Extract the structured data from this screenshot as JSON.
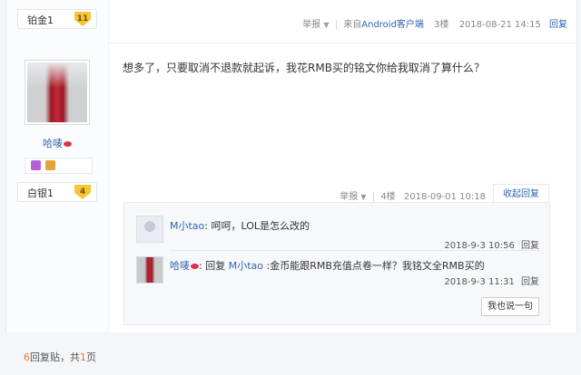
{
  "prev_post": {
    "rank": {
      "label": "铂金1",
      "level": "11"
    },
    "report_label": "举报",
    "source_prefix": "来自",
    "source_link": "Android客户端",
    "floor": "3楼",
    "timestamp": "2018-08-21 14:15",
    "reply_label": "回复"
  },
  "post": {
    "username": "哈唛",
    "rank": {
      "label": "白银1",
      "level": "4"
    },
    "content": "想多了，只要取消不退款就起诉，我花RMB买的铭文你给我取消了算什么？",
    "report_label": "举报",
    "floor": "4楼",
    "timestamp": "2018-09-01 10:18",
    "collapse_label": "收起回复"
  },
  "replies": [
    {
      "author": "M小tao",
      "separator": ":",
      "text": "呵呵，LOL是怎么改的",
      "timestamp": "2018-9-3 10:56",
      "reply_label": "回复"
    },
    {
      "author": "哈唛",
      "separator": ":",
      "reply_word": "回复",
      "target": "M小tao",
      "text": ":金币能跟RMB充值点卷一样？我铭文全RMB买的",
      "timestamp": "2018-9-3 11:31",
      "reply_label": "回复"
    }
  ],
  "say_button": "我也说一句",
  "pager": {
    "count": "6",
    "text_a": "回复贴，共",
    "pages": "1",
    "text_b": "页"
  },
  "colors": {
    "link": "#2d64b3",
    "badge": "#f5c53a",
    "accent": "#e5792b"
  }
}
